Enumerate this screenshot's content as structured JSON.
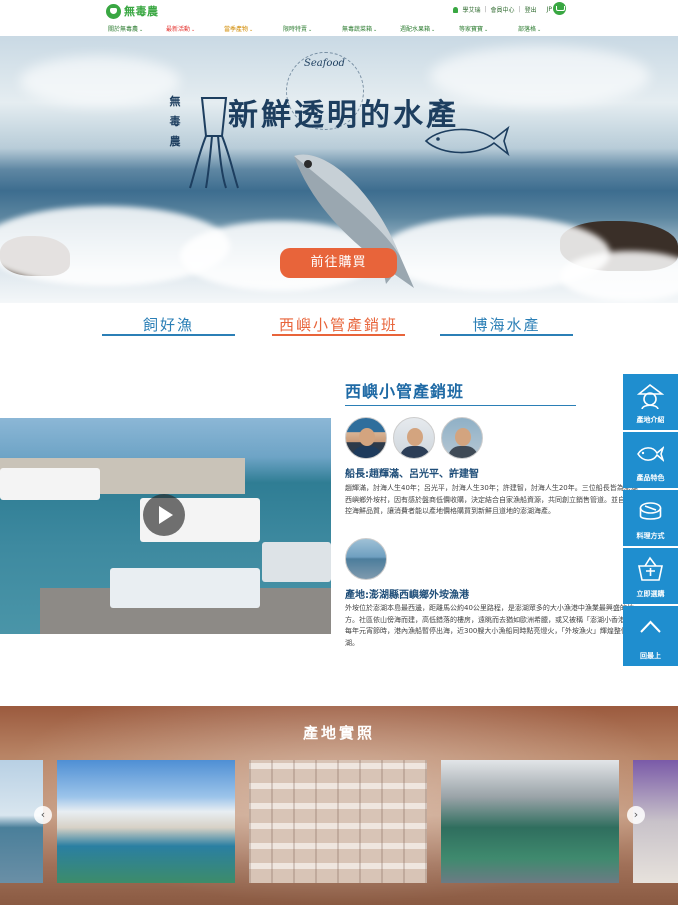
{
  "header": {
    "logo_text": "無毒農",
    "util_links": [
      "學艾瑞",
      "會員中心",
      "登出",
      "JP · EN"
    ],
    "nav": [
      {
        "label": "關於無毒農",
        "color": "#2e7d32"
      },
      {
        "label": "最新活動",
        "color": "#e53935"
      },
      {
        "label": "當季產物",
        "color": "#d18a00"
      },
      {
        "label": "限時特賣",
        "color": "#2e7d32"
      },
      {
        "label": "無毒蔬菜箱",
        "color": "#2e7d32"
      },
      {
        "label": "週配水果箱",
        "color": "#2e7d32"
      },
      {
        "label": "等家寶寶",
        "color": "#2e7d32"
      },
      {
        "label": "部落格",
        "color": "#2e7d32"
      }
    ]
  },
  "hero": {
    "brand_vertical": [
      "無",
      "毒",
      "農"
    ],
    "seafood_badge": "Seafood",
    "title": "新鮮透明的水產",
    "button": "前往購買"
  },
  "tabs": [
    {
      "label": "飼好漁",
      "active": false
    },
    {
      "label": "西嶼小管產銷班",
      "active": true
    },
    {
      "label": "博海水產",
      "active": false
    }
  ],
  "producer": {
    "title": "西嶼小管產銷班",
    "leader_heading": "船長:趙輝滿、呂光平、許建智",
    "leader_text": "趙輝滿，討海人生40年；呂光平，討海人生30年；許建智，討海人生20年。三位船長皆為澎湖西嶼鄉外垵村，因有感於盤商低價收購，決定結合自家漁船資源，共同創立銷售管道。並自主掌控海鮮品質，讓消費者能以產地價格購買到新鮮且道地的澎湖海產。",
    "origin_heading": "產地:澎湖縣西嶼鄉外垵漁港",
    "origin_text": "外垵位於澎湖本島最西邊，距離馬公約40公里路程，是澎湖眾多的大小漁港中漁業最興盛的地方。社區依山傍海而建，高低錯落的樓房，遠眺而去猶如歐洲希臘，或又被稱「澎湖小香港」。每年元宵節時，港內漁船暫停出海，近300艘大小漁船同時點亮燈火，「外垵漁火」輝煌整個澎湖。"
  },
  "side_menu": [
    {
      "label": "產地介紹",
      "icon": "farmer-icon"
    },
    {
      "label": "產品特色",
      "icon": "fish-icon"
    },
    {
      "label": "料理方式",
      "icon": "sushi-icon"
    },
    {
      "label": "立即選購",
      "icon": "basket-icon"
    },
    {
      "label": "回最上",
      "icon": "chevron-up-icon"
    }
  ],
  "gallery": {
    "title": "產地實照",
    "prev": "‹",
    "next": "›"
  },
  "colors": {
    "brand_green": "#39a742",
    "accent_orange": "#e8643a",
    "link_blue": "#2b7fb6",
    "side_blue": "#1f8ecf"
  }
}
